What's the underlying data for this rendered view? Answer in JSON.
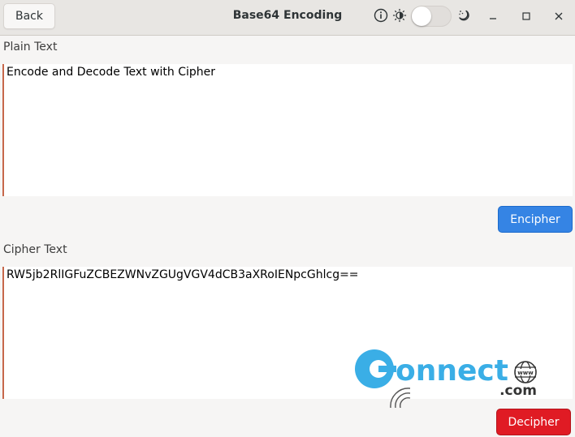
{
  "window": {
    "title": "Base64 Encoding",
    "back_label": "Back",
    "icons": {
      "info": "info-icon",
      "light": "sun-icon",
      "dark": "moon-icon",
      "minimize": "minimize-icon",
      "maximize": "maximize-icon",
      "close": "close-icon"
    },
    "dark_mode_toggle": false
  },
  "plain": {
    "label": "Plain Text",
    "value": "Encode and Decode Text with Cipher",
    "button_label": "Encipher"
  },
  "cipher": {
    "label": "Cipher Text",
    "value": "RW5jb2RlIGFuZCBEZWNvZGUgVGV4dCB3aXRoIENpcGhlcg==",
    "button_label": "Decipher"
  },
  "watermark": {
    "brand": "onnect",
    "suffix": ".com",
    "globe_text": "www"
  },
  "colors": {
    "accent_blue": "#3584e4",
    "destructive_red": "#e01b24",
    "focus_border": "#c7684b",
    "watermark_blue": "#3aaee6"
  }
}
